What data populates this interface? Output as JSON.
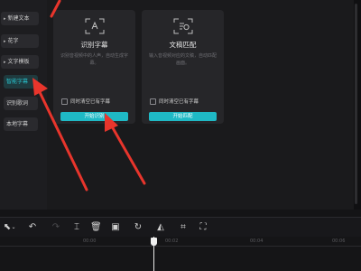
{
  "sidebar": {
    "items": [
      {
        "label": "新建文本",
        "caret": "▸"
      },
      {
        "label": "花字",
        "caret": "▸"
      },
      {
        "label": "文字模板",
        "caret": "▸"
      },
      {
        "label": "智能字幕",
        "caret": "",
        "active": true
      },
      {
        "label": "识别歌词",
        "caret": ""
      },
      {
        "label": "本地字幕",
        "caret": ""
      }
    ]
  },
  "cards": [
    {
      "title": "识别字幕",
      "description": "识别音视频中的人声，自动生成字幕。",
      "checkbox_label": "同时清空已有字幕",
      "button_label": "开始识别",
      "icon": "subtitle-recognize-icon"
    },
    {
      "title": "文稿匹配",
      "description": "输入音视频对应的文稿，自动匹配画面。",
      "checkbox_label": "同时清空已有字幕",
      "button_label": "开始匹配",
      "icon": "script-match-icon"
    }
  ],
  "toolbar": {
    "icons": [
      "select-pointer-icon",
      "chevron-down-icon",
      "undo-icon",
      "redo-icon",
      "split-icon",
      "delete-icon",
      "freeze-frame-icon",
      "reverse-icon",
      "mirror-icon",
      "crop-icon"
    ]
  },
  "timeline": {
    "ticks": [
      "00:00",
      "00:02",
      "00:04",
      "00:06"
    ]
  },
  "colors": {
    "accent": "#1fb9c5",
    "annotation_arrow": "#e8352c",
    "background": "#141416"
  }
}
